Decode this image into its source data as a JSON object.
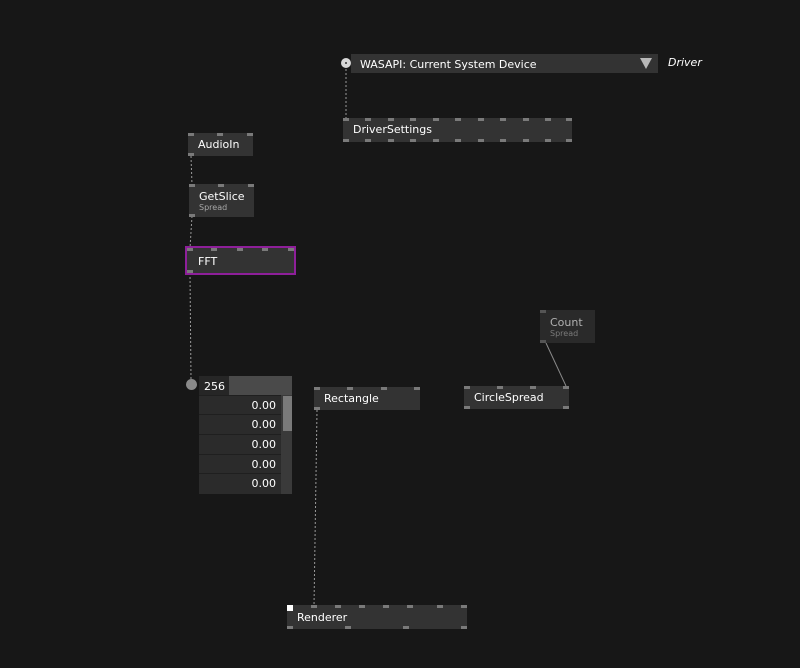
{
  "enum": {
    "value": "WASAPI: Current System Device",
    "label": "Driver"
  },
  "nodes": {
    "driver_settings": {
      "title": "DriverSettings"
    },
    "audio_in": {
      "title": "AudioIn"
    },
    "get_slice": {
      "title": "GetSlice",
      "category": "Spread"
    },
    "fft": {
      "title": "FFT"
    },
    "count": {
      "title": "Count",
      "category": "Spread"
    },
    "rectangle": {
      "title": "Rectangle"
    },
    "circle_spread": {
      "title": "CircleSpread"
    },
    "renderer": {
      "title": "Renderer"
    }
  },
  "iobox": {
    "count": "256",
    "values": [
      "0.00",
      "0.00",
      "0.00",
      "0.00",
      "0.00"
    ]
  },
  "colors": {
    "background": "#171717",
    "node": "#333333",
    "selected": "#8e1f9a",
    "pin": "#7a7a7a",
    "link": "#9a9a9a"
  }
}
